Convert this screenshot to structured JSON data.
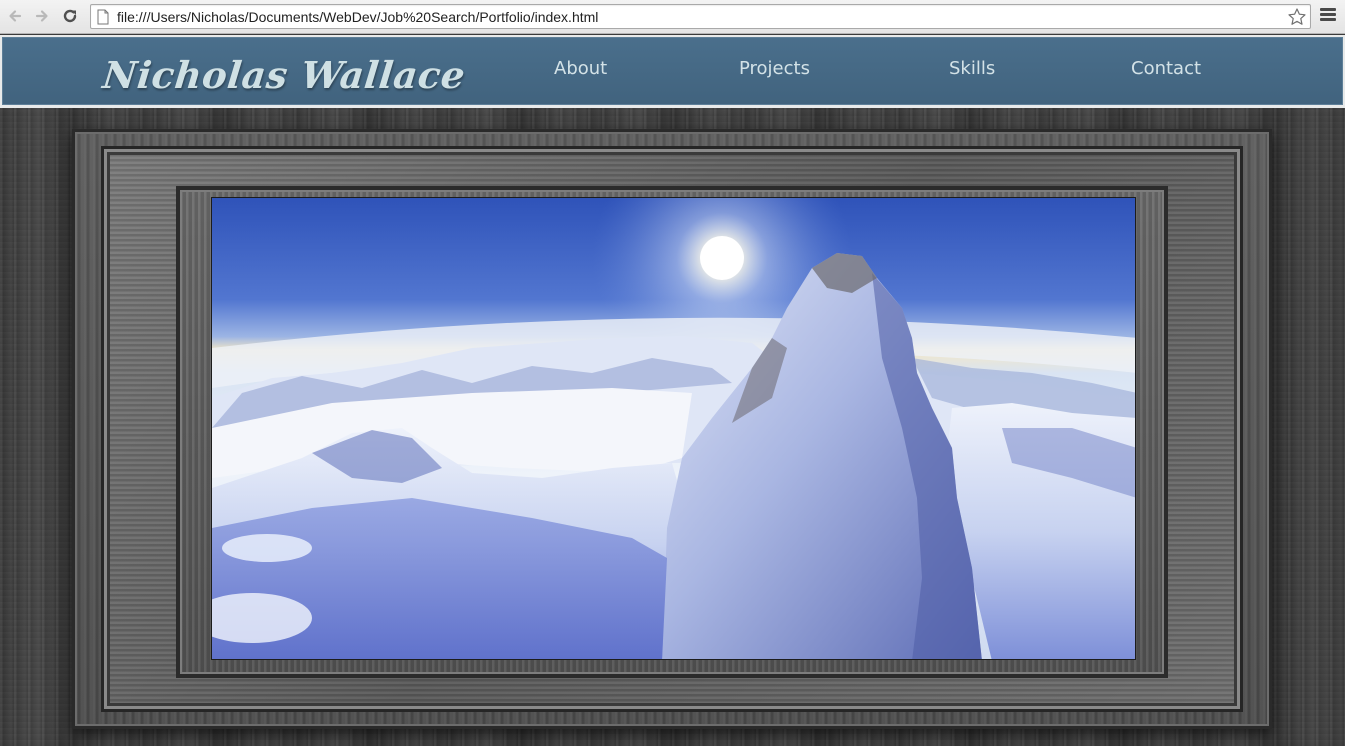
{
  "browser": {
    "url": "file:///Users/Nicholas/Documents/WebDev/Job%20Search/Portfolio/index.html",
    "icons": {
      "back": "back-arrow-icon",
      "forward": "forward-arrow-icon",
      "reload": "reload-icon",
      "page": "page-icon",
      "bookmark": "star-icon",
      "menu": "hamburger-menu-icon"
    }
  },
  "site": {
    "brand": "Nicholas Wallace",
    "nav": [
      {
        "label": "About"
      },
      {
        "label": "Projects"
      },
      {
        "label": "Skills"
      },
      {
        "label": "Contact"
      }
    ]
  },
  "colors": {
    "header_blue": "#45687f",
    "brand_text": "#cfe0e4",
    "nav_text": "#d3e2e7",
    "wood_gray": "#3e3e3e"
  }
}
